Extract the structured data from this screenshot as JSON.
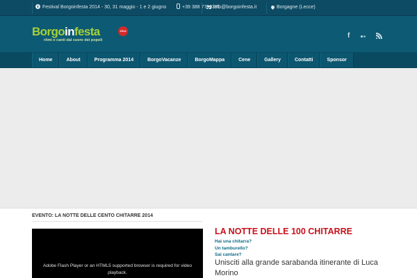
{
  "topbar": {
    "event": "Festival Borgoinfesta 2014 - 30, 31 maggio - 1 e 2 giugno",
    "phone": "+39 388 7710391",
    "email": "info@borgoinfesta.it",
    "location": "Borgagne (Lecce)"
  },
  "header": {
    "logo_main_1": "Borgo",
    "logo_main_2": "in",
    "logo_main_3": "festa",
    "logo_badge": "2014",
    "logo_tagline": "ritmi e canti dal cuore dei popoli",
    "social_facebook": "f",
    "social_icons": [
      "facebook-icon",
      "flickr-icon",
      "rss-icon"
    ]
  },
  "nav": {
    "items": [
      "Home",
      "About",
      "Programma 2014",
      "BorgoVacanze",
      "BorgoMappa",
      "Cene",
      "Gallery",
      "Contatti",
      "Sponsor"
    ]
  },
  "content": {
    "event_title": "EVENTO: LA NOTTE DELLE CENTO CHITARRE 2014",
    "video_message": "Adobe Flash Player or an HTML5 supported browser is required for video playback.",
    "post_title": "LA NOTTE DELLE 100 CHITARRE",
    "post_lines": [
      "Hai una chitarra?",
      "Un tamburello?",
      "Sai cantare?"
    ],
    "post_lead": "Unisciti alla grande sarabanda itinerante di Luca Morino"
  },
  "colors": {
    "topbar_bg": "#0d4a63",
    "header_bg": "#0d5a74",
    "nav_bg": "#0c5670",
    "logo_green": "#a6d13a",
    "post_title_red": "#c8101a",
    "link_blue": "#0f6a86"
  }
}
